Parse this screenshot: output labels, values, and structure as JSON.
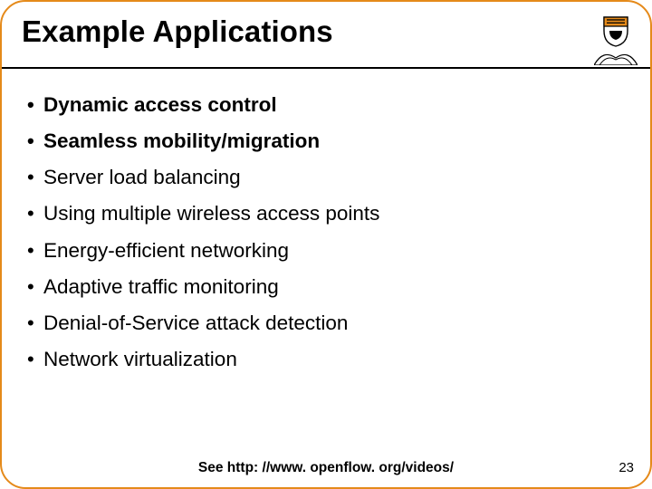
{
  "header": {
    "title": "Example Applications"
  },
  "bullets": [
    {
      "text": "Dynamic access control",
      "bold": true
    },
    {
      "text": "Seamless mobility/migration",
      "bold": true
    },
    {
      "text": "Server load balancing",
      "bold": false
    },
    {
      "text": "Using multiple wireless access points",
      "bold": false
    },
    {
      "text": "Energy-efficient networking",
      "bold": false
    },
    {
      "text": "Adaptive traffic monitoring",
      "bold": false
    },
    {
      "text": "Denial-of-Service attack detection",
      "bold": false
    },
    {
      "text": "Network virtualization",
      "bold": false
    }
  ],
  "footer": {
    "note": "See http: //www. openflow. org/videos/"
  },
  "page_number": "23"
}
